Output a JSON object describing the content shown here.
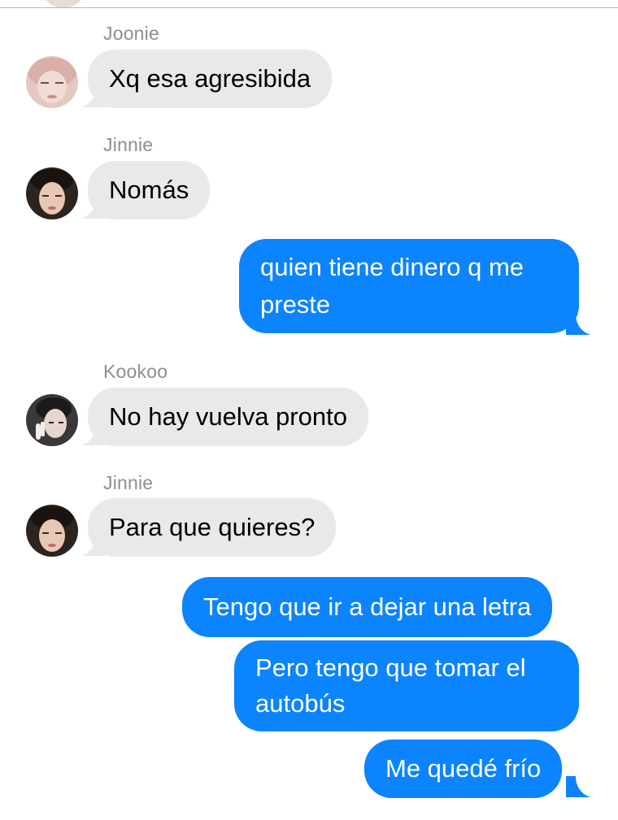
{
  "colors": {
    "incoming_bubble": "#e9e9eb",
    "outgoing_bubble": "#0b84fe",
    "sender_name": "#8e8e93"
  },
  "messages": [
    {
      "direction": "incoming",
      "sender": "Joonie",
      "text": "Xq esa agresibida",
      "avatar": "avatar-joonie"
    },
    {
      "direction": "incoming",
      "sender": "Jinnie",
      "text": "Nomás",
      "avatar": "avatar-jinnie"
    },
    {
      "direction": "outgoing",
      "text": "quien tiene dinero q me preste"
    },
    {
      "direction": "incoming",
      "sender": "Kookoo",
      "text": "No hay vuelva pronto",
      "avatar": "avatar-kookoo"
    },
    {
      "direction": "incoming",
      "sender": "Jinnie",
      "text": "Para que quieres?",
      "avatar": "avatar-jinnie"
    },
    {
      "direction": "outgoing",
      "text": "Tengo que ir a dejar una letra"
    },
    {
      "direction": "outgoing",
      "text": "Pero tengo que tomar el autobús"
    },
    {
      "direction": "outgoing",
      "text": "Me quedé frío"
    }
  ]
}
